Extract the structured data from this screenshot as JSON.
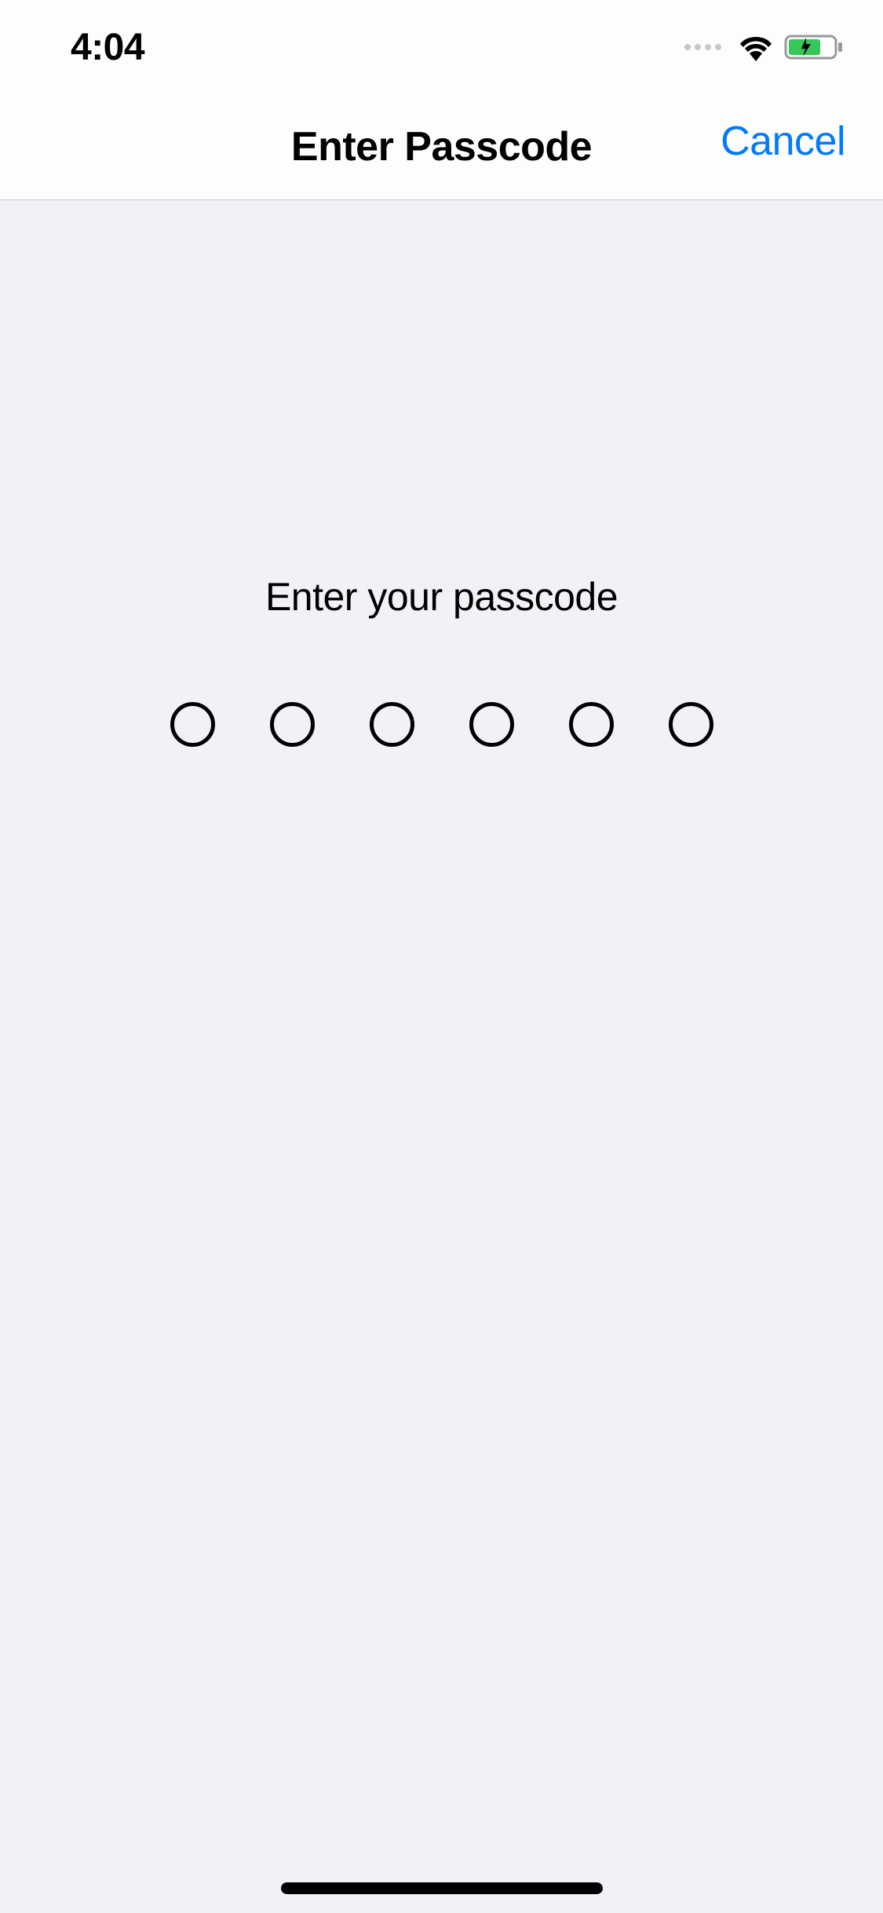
{
  "statusBar": {
    "time": "4:04"
  },
  "nav": {
    "title": "Enter Passcode",
    "cancel": "Cancel"
  },
  "content": {
    "prompt": "Enter your passcode",
    "passcodeLength": 6,
    "enteredCount": 0
  }
}
